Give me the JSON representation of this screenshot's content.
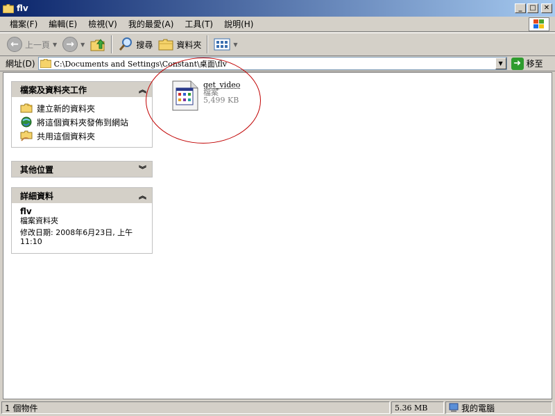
{
  "window": {
    "title": "flv",
    "minimize": "_",
    "maximize": "□",
    "close": "✕"
  },
  "menu": [
    "檔案(F)",
    "編輯(E)",
    "檢視(V)",
    "我的最愛(A)",
    "工具(T)",
    "說明(H)"
  ],
  "toolbar": {
    "back": "上一頁",
    "search": "搜尋",
    "folders": "資料夾"
  },
  "address": {
    "label": "網址(D)",
    "path": "C:\\Documents and Settings\\Constant\\桌面\\flv",
    "go": "移至"
  },
  "panels": {
    "tasks": {
      "title": "檔案及資料夾工作",
      "items": [
        {
          "label": "建立新的資料夾",
          "icon": "new-folder-icon"
        },
        {
          "label": "將這個資料夾發佈到網站",
          "icon": "publish-web-icon"
        },
        {
          "label": "共用這個資料夾",
          "icon": "share-folder-icon"
        }
      ]
    },
    "other": {
      "title": "其他位置"
    },
    "details": {
      "title": "詳細資料",
      "name": "flv",
      "type": "檔案資料夾",
      "modified": "修改日期: 2008年6月23日, 上午 11:10"
    }
  },
  "file": {
    "name": "get_video",
    "type": "檔案",
    "size": "5,499 KB",
    "icon": "generic-file-icon"
  },
  "status": {
    "count": "1 個物件",
    "size": "5.36 MB",
    "location": "我的電腦"
  },
  "colors": {
    "titlebar_start": "#0a246a",
    "titlebar_end": "#a6caf0",
    "annotation": "#c00000"
  }
}
